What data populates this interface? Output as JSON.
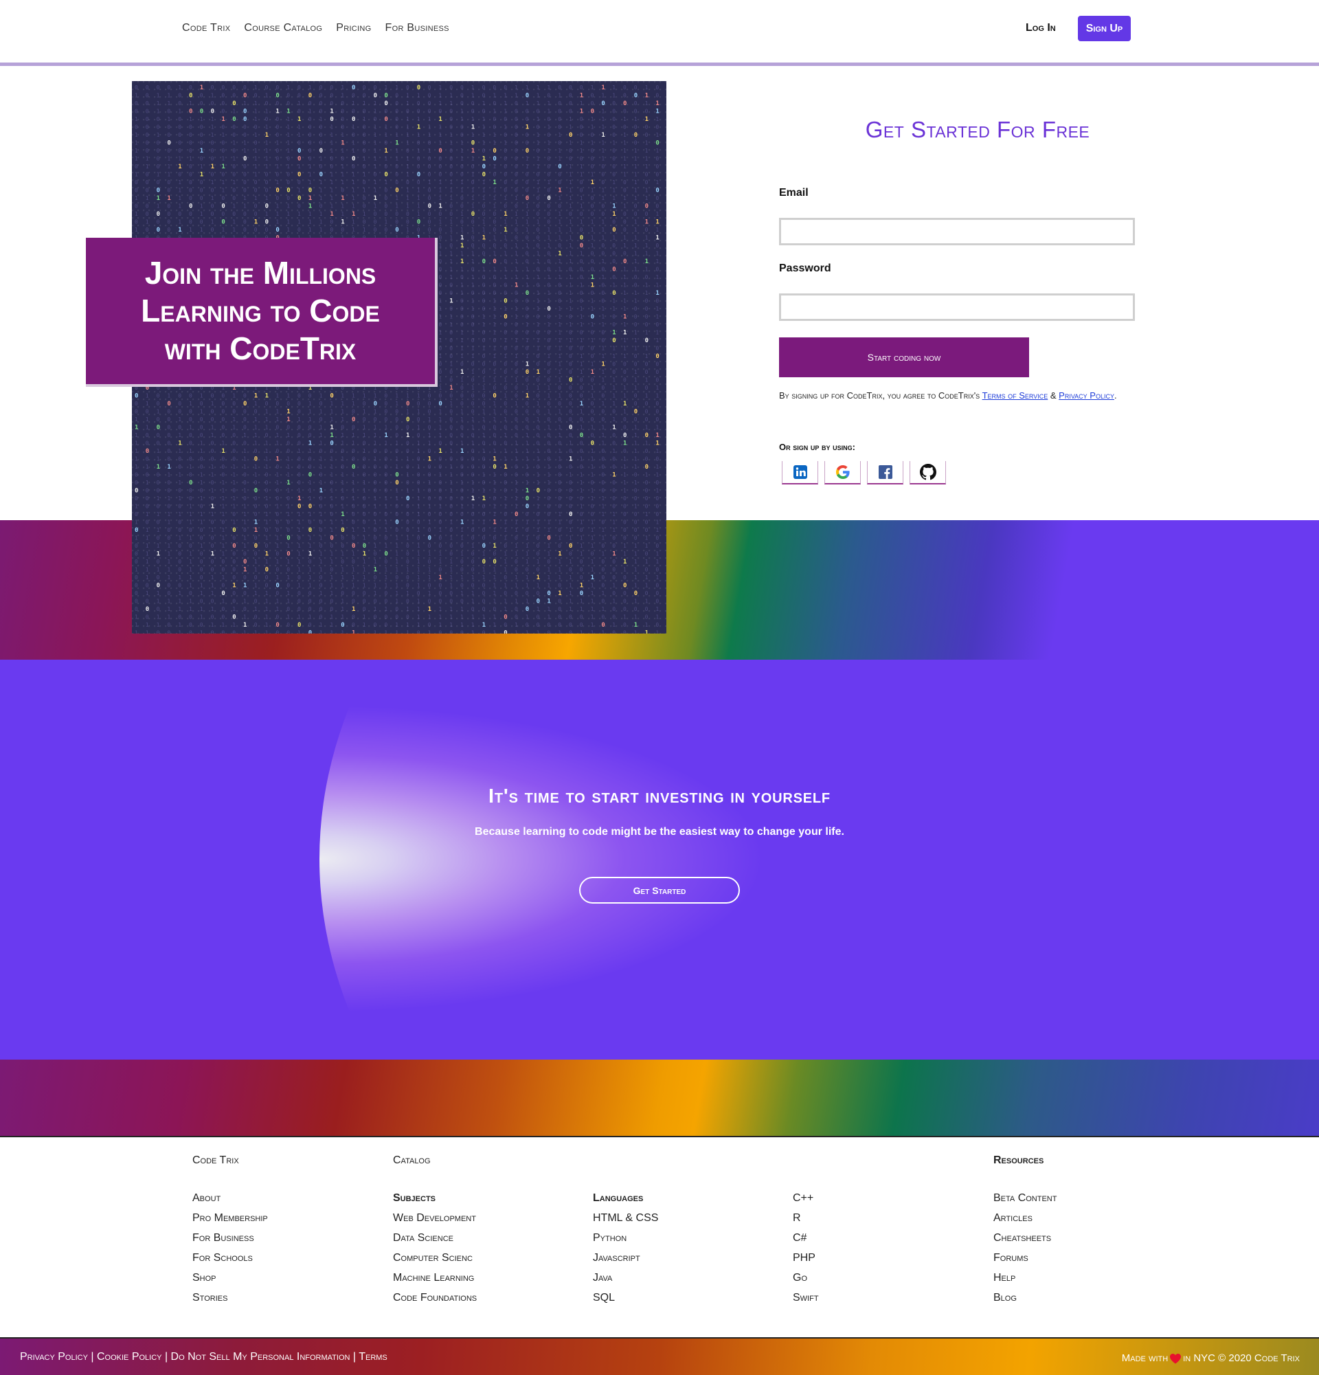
{
  "nav": {
    "links": [
      "Code Trix",
      "Course Catalog",
      "Pricing",
      "For Business"
    ],
    "login": "Log In",
    "signup": "Sign Up"
  },
  "hero": {
    "promo_lines": [
      "Join the Millions",
      "Learning to Code",
      "with CodeTrix"
    ]
  },
  "form": {
    "title": "Get Started For Free",
    "email_label": "Email",
    "email_value": "",
    "password_label": "Password",
    "password_value": "",
    "submit": "Start coding now",
    "terms_prefix": "By signing up for CodeTrix, you agree to CodeTrix's ",
    "terms_link": "Terms of Service",
    "terms_amp": " & ",
    "privacy_link": "Privacy Policy",
    "terms_suffix": ".",
    "or_signup": "Or sign up by using:",
    "socials": [
      "linkedin-icon",
      "google-icon",
      "facebook-icon",
      "github-icon"
    ]
  },
  "invest": {
    "heading": "It's time to start investing in yourself",
    "sub": "Because learning to code might be the easiest way to change your life.",
    "cta": "Get Started"
  },
  "footer": {
    "brand": "Code Trix",
    "catalog": "Catalog",
    "resources_head": "Resources",
    "company": [
      "About",
      "Pro Membership",
      "For Business",
      "For Schools",
      "Shop",
      "Stories"
    ],
    "subjects_head": "Subjects",
    "subjects": [
      "Web Development",
      "Data Science",
      "Computer Scienc",
      "Machine Learning",
      "Code Foundations"
    ],
    "languages_head": "Languages",
    "languages": [
      "HTML & CSS",
      "Python",
      "Javascript",
      "Java",
      "SQL"
    ],
    "languages2": [
      "C++",
      "R",
      "C#",
      "PHP",
      "Go",
      "Swift"
    ],
    "resources": [
      "Beta Content",
      "Articles",
      "Cheatsheets",
      "Forums",
      "Help",
      "Blog"
    ]
  },
  "bottom": {
    "legal": "Privacy Policy | Cookie Policy | Do Not Sell My Personal Information | Terms",
    "made_prefix": "Made with",
    "made_suffix": "in NYC © 2020 Code Trix"
  },
  "colors": {
    "accent": "#6338e6",
    "brand_purple": "#7b1a7c",
    "title_purple": "#6a32d6",
    "middle_bg": "#6a3af0"
  }
}
